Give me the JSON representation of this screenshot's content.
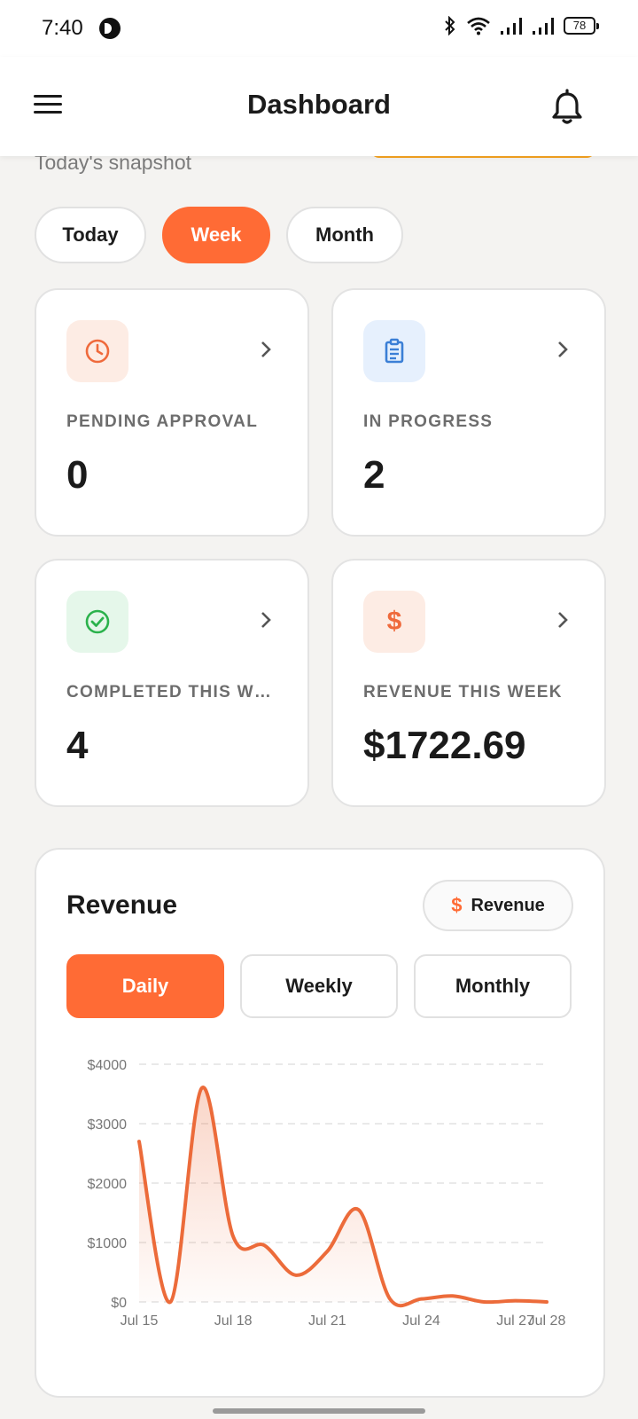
{
  "status_bar": {
    "time": "7:40",
    "battery": "78",
    "icons": [
      "dnd-icon",
      "bluetooth-icon",
      "wifi-icon",
      "signal-icon",
      "signal-icon",
      "battery-icon"
    ]
  },
  "app_bar": {
    "title": "Dashboard",
    "menu_icon": "hamburger-menu-icon",
    "bell_icon": "bell-icon"
  },
  "subtitle": "Today's snapshot",
  "period_tabs": {
    "items": [
      "Today",
      "Week",
      "Month"
    ],
    "selected": "Week"
  },
  "stat_cards": [
    {
      "label": "PENDING APPROVAL",
      "value": "0",
      "icon": "clock-icon",
      "icon_color": "#ef6a3c",
      "icon_bg": "#fdece4"
    },
    {
      "label": "IN PROGRESS",
      "value": "2",
      "icon": "clipboard-icon",
      "icon_color": "#3b7fd6",
      "icon_bg": "#e6f0fd"
    },
    {
      "label": "COMPLETED THIS W…",
      "value": "4",
      "icon": "check-circle-icon",
      "icon_color": "#2bb24c",
      "icon_bg": "#e5f7ea"
    },
    {
      "label": "REVENUE THIS WEEK",
      "value": "$1722.69",
      "icon": "dollar-icon",
      "icon_color": "#ef6a3c",
      "icon_bg": "#fdece4"
    }
  ],
  "revenue": {
    "title": "Revenue",
    "chip_label": "Revenue",
    "chip_icon": "$",
    "granularity": {
      "items": [
        "Daily",
        "Weekly",
        "Monthly"
      ],
      "selected": "Daily"
    }
  },
  "colors": {
    "accent": "#ff6b35",
    "line": "#ec6b3a",
    "text_primary": "#1c1c1c",
    "text_muted": "#6d6d6d",
    "background": "#f4f3f1"
  },
  "chart_data": {
    "type": "area",
    "title": "Revenue",
    "x": [
      "Jul 15",
      "Jul 16",
      "Jul 17",
      "Jul 18",
      "Jul 19",
      "Jul 20",
      "Jul 21",
      "Jul 22",
      "Jul 23",
      "Jul 24",
      "Jul 25",
      "Jul 26",
      "Jul 27",
      "Jul 28"
    ],
    "values": [
      2700,
      0,
      3600,
      1100,
      950,
      450,
      850,
      1550,
      50,
      50,
      100,
      0,
      20,
      0
    ],
    "x_tick_labels": [
      "Jul 15",
      "Jul 18",
      "Jul 21",
      "Jul 24",
      "Jul 27",
      "Jul 28"
    ],
    "y_tick_labels": [
      "$0",
      "$1000",
      "$2000",
      "$3000",
      "$4000"
    ],
    "ylim": [
      0,
      4000
    ],
    "grid": "horizontal dashed",
    "legend": "none"
  }
}
